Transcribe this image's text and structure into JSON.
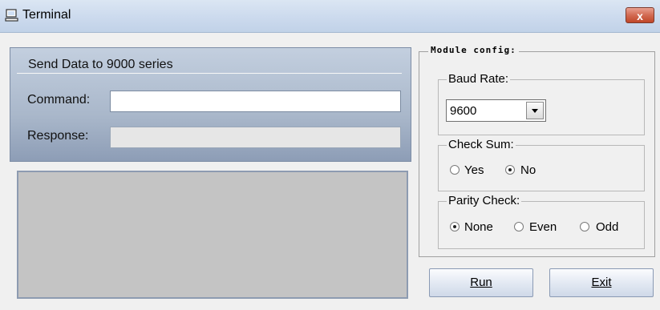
{
  "window": {
    "title": "Terminal",
    "close_label": "x",
    "app_icon": "computer-icon"
  },
  "send": {
    "group_title": "Send Data to 9000 series",
    "command_label": "Command:",
    "command_value": "",
    "response_label": "Response:",
    "response_value": ""
  },
  "output": {
    "text": ""
  },
  "module": {
    "title": "Module config:",
    "baud": {
      "label": "Baud Rate:",
      "selected": "9600"
    },
    "checksum": {
      "label": "Check Sum:",
      "options": [
        {
          "label": "Yes",
          "checked": false
        },
        {
          "label": "No",
          "checked": true
        }
      ]
    },
    "parity": {
      "label": "Parity Check:",
      "options": [
        {
          "label": "None",
          "checked": true
        },
        {
          "label": "Even",
          "checked": false
        },
        {
          "label": "Odd",
          "checked": false
        }
      ]
    }
  },
  "buttons": {
    "run": "Run",
    "exit": "Exit"
  },
  "colors": {
    "panel": "#a9b7ca",
    "output_bg": "#c4c4c4",
    "close": "#d26a52"
  }
}
